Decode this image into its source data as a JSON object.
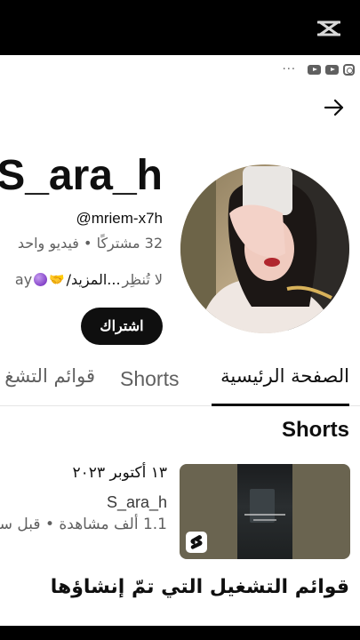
{
  "channel": {
    "name": "S_ara_h",
    "handle": "@mriem-x7h",
    "stats": "32 مشتركًا • فيديو واحد",
    "bio_prefix": "لا تُنظِر",
    "bio_more": "...المزيد/",
    "bio_suffix": "ay",
    "subscribe_label": "اشتراك"
  },
  "header": {
    "more_dots": "···"
  },
  "tabs": {
    "home": "الصفحة الرئيسية",
    "shorts": "Shorts",
    "playlists": "قوائم التشغ"
  },
  "shorts_section": {
    "title": "Shorts",
    "item": {
      "date": "١٣ أكتوبر ٢٠٢٣",
      "title": "S_ara_h",
      "meta": "1.1 ألف مشاهدة • قبل سـ"
    }
  },
  "playlists_section": {
    "title": "قوائم التشغيل التي تمّ إنشاؤها"
  },
  "icons": [
    "capcut-icon",
    "youtube-icon",
    "youtube-icon",
    "instagram-icon",
    "arrow-right-icon",
    "shorts-logo-icon"
  ],
  "colors": {
    "primary_text": "#0f0f0f",
    "secondary_text": "#606060",
    "subscribe_bg": "#0f0f0f"
  }
}
